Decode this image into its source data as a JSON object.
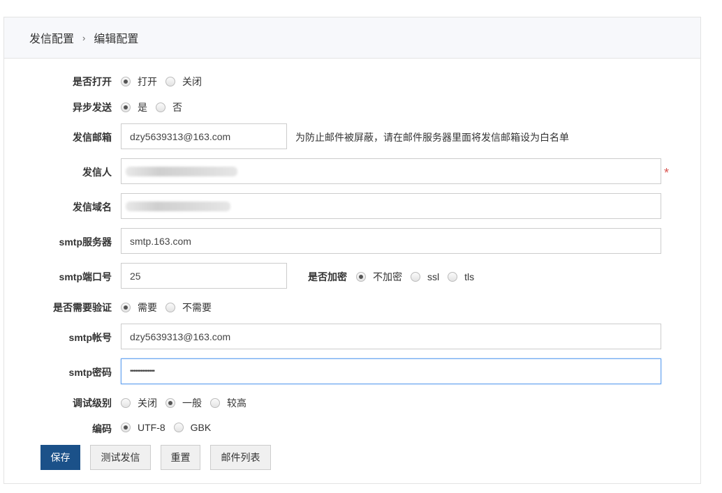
{
  "breadcrumb": {
    "parent": "发信配置",
    "separator": "›",
    "current": "编辑配置"
  },
  "form": {
    "enabled": {
      "label": "是否打开",
      "options": [
        "打开",
        "关闭"
      ],
      "selected": 0
    },
    "async": {
      "label": "异步发送",
      "options": [
        "是",
        "否"
      ],
      "selected": 0
    },
    "sender_email": {
      "label": "发信邮箱",
      "value": "dzy5639313@163.com",
      "hint": "为防止邮件被屏蔽，请在邮件服务器里面将发信邮箱设为白名单"
    },
    "sender_name": {
      "label": "发信人",
      "required_mark": "*"
    },
    "sender_domain": {
      "label": "发信域名"
    },
    "smtp_server": {
      "label": "smtp服务器",
      "value": "smtp.163.com"
    },
    "smtp_port": {
      "label": "smtp端口号",
      "value": "25"
    },
    "encryption": {
      "label": "是否加密",
      "options": [
        "不加密",
        "ssl",
        "tls"
      ],
      "selected": 0
    },
    "auth": {
      "label": "是否需要验证",
      "options": [
        "需要",
        "不需要"
      ],
      "selected": 0
    },
    "smtp_account": {
      "label": "smtp帐号",
      "value": "dzy5639313@163.com"
    },
    "smtp_password": {
      "label": "smtp密码",
      "value": "••••••••••••••"
    },
    "debug_level": {
      "label": "调试级别",
      "options": [
        "关闭",
        "一般",
        "较高"
      ],
      "selected": 1
    },
    "encoding": {
      "label": "编码",
      "options": [
        "UTF-8",
        "GBK"
      ],
      "selected": 0
    }
  },
  "buttons": {
    "save": "保存",
    "test": "测试发信",
    "reset": "重置",
    "mail_list": "邮件列表"
  }
}
